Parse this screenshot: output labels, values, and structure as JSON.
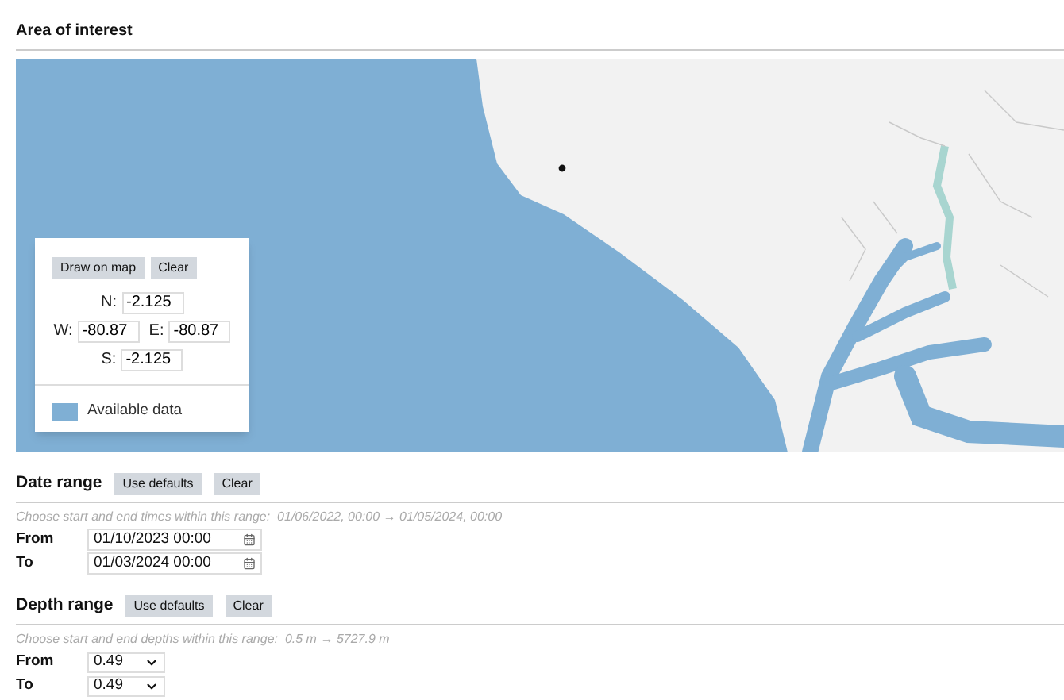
{
  "area": {
    "title": "Area of interest",
    "map": {
      "buttons": [
        "Draw on map",
        "Clear"
      ],
      "north": {
        "label": "N:",
        "value": "-2.125"
      },
      "west": {
        "label": "W:",
        "value": "-80.87"
      },
      "east": {
        "label": "E:",
        "value": "-80.87"
      },
      "south": {
        "label": "S:",
        "value": "-2.125"
      },
      "legend": "Available data"
    }
  },
  "date_range": {
    "title": "Date range",
    "buttons": [
      "Use defaults",
      "Clear"
    ],
    "hint": "Choose start and end times within this range:",
    "range_start": "01/06/2022, 00:00",
    "arrow": "→",
    "range_end": "01/05/2024, 00:00",
    "fields": [
      {
        "label": "From",
        "value": "01/10/2023 00:00"
      },
      {
        "label": "To",
        "value": "01/03/2024 00:00"
      }
    ]
  },
  "depth_range": {
    "title": "Depth range",
    "buttons": [
      "Use defaults",
      "Clear"
    ],
    "hint": "Choose start and end depths within this range:",
    "range_start": "0.5 m",
    "arrow": "→",
    "range_end": "5727.9 m",
    "fields": [
      {
        "label": "From",
        "value": "0.49"
      },
      {
        "label": "To",
        "value": "0.49"
      }
    ]
  }
}
